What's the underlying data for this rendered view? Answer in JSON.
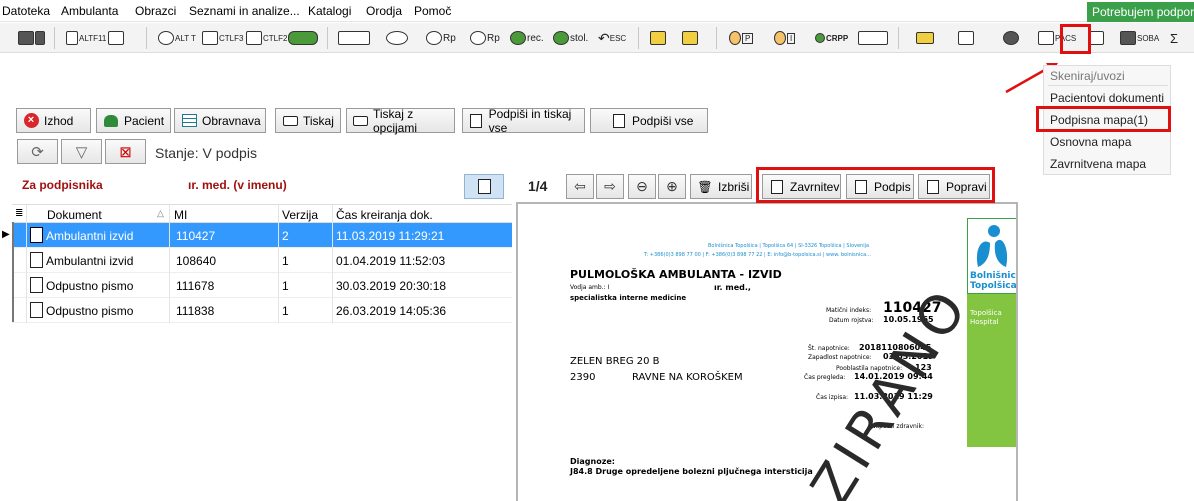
{
  "menu": [
    "Datoteka",
    "Ambulanta",
    "Obrazci",
    "Seznami in analize...",
    "Katalogi",
    "Orodja",
    "Pomoč"
  ],
  "help_badge": "Potrebujem podporo",
  "toolbar": [
    {
      "icon": "scanner-icon",
      "label": ""
    },
    {
      "icon": "tree-icon",
      "label": "ALTF11"
    },
    {
      "icon": "copy-doc-icon",
      "label": ""
    },
    {
      "icon": "stamp-icon",
      "label": "ALT T"
    },
    {
      "icon": "erase-icon",
      "label": "CTLF3"
    },
    {
      "icon": "erase2-icon",
      "label": "CTLF2"
    },
    {
      "icon": "pills-icon",
      "label": ""
    },
    {
      "icon": "pill-doc-icon",
      "label": ""
    },
    {
      "icon": "pill-icon",
      "label": ""
    },
    {
      "icon": "rp-icon",
      "label": "Rp"
    },
    {
      "icon": "rp2-icon",
      "label": "Rp"
    },
    {
      "icon": "rec-icon",
      "label": "rec."
    },
    {
      "icon": "stol-icon",
      "label": "stol."
    },
    {
      "icon": "undo-icon",
      "label": "ESC"
    },
    {
      "icon": "puzzle-icon",
      "label": ""
    },
    {
      "icon": "folders-icon",
      "label": ""
    },
    {
      "icon": "ep-icon",
      "label": "P"
    },
    {
      "icon": "ei-icon",
      "label": "I"
    },
    {
      "icon": "crpp-icon",
      "label": "CRPP"
    },
    {
      "icon": "cards-icon",
      "label": ""
    },
    {
      "icon": "envelope-icon",
      "label": ""
    },
    {
      "icon": "form-icon",
      "label": ""
    },
    {
      "icon": "camera-icon",
      "label": ""
    },
    {
      "icon": "pacs-icon",
      "label": "PACS"
    },
    {
      "icon": "scan-print-icon",
      "label": ""
    },
    {
      "icon": "room-icon",
      "label": "SOBA"
    },
    {
      "icon": "sum-icon",
      "label": "Σ"
    }
  ],
  "scan_menu": {
    "header": "Skeniraj/uvozi",
    "items": [
      "Pacientovi dokumenti",
      "Podpisna mapa(1)",
      "Osnovna mapa",
      "Zavrnitvena mapa"
    ],
    "highlighted": "Podpisna mapa(1)"
  },
  "actions": {
    "izhod": "Izhod",
    "pacient": "Pacient",
    "obravnava": "Obravnava",
    "tiskaj": "Tiskaj",
    "tiskaj_opcije": "Tiskaj z opcijami",
    "podpisi_tiskaj": "Podpiši in tiskaj vse",
    "podpisi_vse": "Podpiši vse"
  },
  "filter": {
    "status_text": "Stanje: V podpis"
  },
  "signee": {
    "label": "Za podpisnika",
    "rest": "ır. med. (v imenu)"
  },
  "grid": {
    "columns": [
      "Dokument",
      "MI",
      "Verzija",
      "Čas kreiranja dok."
    ],
    "rows": [
      {
        "dokument": "Ambulantni izvid",
        "mi": "110427",
        "verzija": "2",
        "cas": "11.03.2019 11:29:21",
        "selected": true
      },
      {
        "dokument": "Ambulantni izvid",
        "mi": "108640",
        "verzija": "1",
        "cas": "01.04.2019 11:52:03",
        "selected": false
      },
      {
        "dokument": "Odpustno pismo",
        "mi": "111678",
        "verzija": "1",
        "cas": "30.03.2019 20:30:18",
        "selected": false
      },
      {
        "dokument": "Odpustno pismo",
        "mi": "111838",
        "verzija": "1",
        "cas": "26.03.2019 14:05:36",
        "selected": false
      }
    ]
  },
  "viewer": {
    "pager": "1/4",
    "izbrisi": "Izbriši",
    "zavrnitev": "Zavrnitev",
    "podpis": "Podpis",
    "popravi": "Popravi"
  },
  "document": {
    "hospital_line1": "Bolnišnica Topolšica | Topolšica 64 | SI-3326 Topolšica | Slovenija",
    "hospital_line2": "T: +386(0)3 898 77 00 | F: +386(0)3 898 77 22 | E: info@b-topolsica.si | www. bolnisnica...",
    "title": "PULMOLOŠKA AMBULANTA - IZVID",
    "vodja_label": "Vodja amb.: I",
    "vodja_rest": "ır. med.,",
    "specialist": "specialistka interne medicine",
    "maticni_label": "Matični indeks:",
    "maticni_value": "110427",
    "rojstvo_label": "Datum rojstva:",
    "rojstvo_value": "10.05.1965",
    "napotnica_label": "Št. napotnice:",
    "napotnica_value": "2018110806045",
    "zapadlost_label": "Zapadlost napotnice:",
    "zapadlost_value": "03.03.2019",
    "pooblastilo_label": "Pooblastila napotnice:",
    "pooblastilo_value": "123",
    "pregled_label": "Čas pregleda:",
    "pregled_value": "14.01.2019 09:44",
    "izpis_label": "Čas izpisa:",
    "izpis_value": "11.03.2019 11:29",
    "address1": "ZELEN BREG 20 B",
    "postcode": "2390",
    "city": "RAVNE NA KOROŠKEM",
    "napotni_label": "Napotni zdravnik:",
    "diagnoze_label": "Diagnoze:",
    "diagnoze_value": "J84.8   Druge opredeljene bolezni pljučnega intersticija",
    "logo_text1": "Bolnišnica",
    "logo_text2": "Topolšica",
    "logo_small1": "Topolšica",
    "logo_small2": "Hospital",
    "watermark": "ZIRANO"
  },
  "colors": {
    "highlight_red": "#e01010",
    "selected_row": "#3399ff",
    "signee_red": "#a01010",
    "logo_green": "#83c441",
    "badge_green": "#3aa04a"
  }
}
